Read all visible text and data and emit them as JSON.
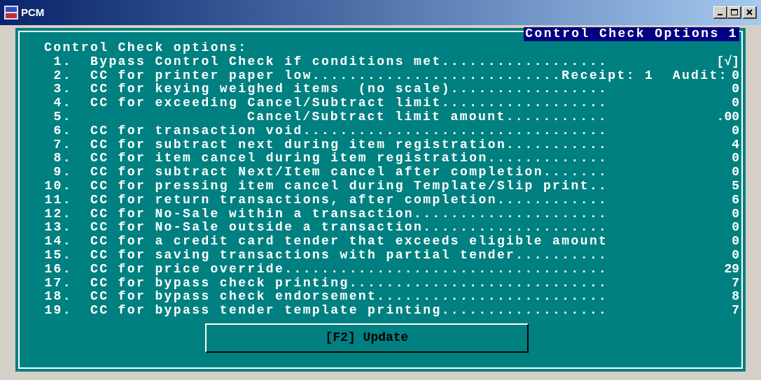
{
  "window": {
    "title": "PCM"
  },
  "panel": {
    "title": "Control Check Options 1",
    "heading": "Control Check options:"
  },
  "items": [
    {
      "number": "1.",
      "kind": "item",
      "label": "Bypass Control Check if conditions met..................",
      "value": "[√]"
    },
    {
      "number": "2.",
      "kind": "item",
      "label": "CC for printer paper low...........................Receipt: 1  Audit:",
      "value": "0"
    },
    {
      "number": "3.",
      "kind": "item",
      "label": "CC for keying weighed items  (no scale).................",
      "value": "0"
    },
    {
      "number": "4.",
      "kind": "item",
      "label": "CC for exceeding Cancel/Subtract limit..................",
      "value": "0"
    },
    {
      "number": "5.",
      "kind": "subitem",
      "label": "Cancel/Subtract limit amount...........",
      "value": ".00"
    },
    {
      "number": "6.",
      "kind": "item",
      "label": "CC for transaction void.................................",
      "value": "0"
    },
    {
      "number": "7.",
      "kind": "item",
      "label": "CC for subtract next during item registration...........",
      "value": "4"
    },
    {
      "number": "8.",
      "kind": "item",
      "label": "CC for item cancel during item registration.............",
      "value": "0"
    },
    {
      "number": "9.",
      "kind": "item",
      "label": "CC for subtract Next/Item cancel after completion.......",
      "value": "0"
    },
    {
      "number": "10.",
      "kind": "item",
      "label": "CC for pressing item cancel during Template/Slip print..",
      "value": "5"
    },
    {
      "number": "11.",
      "kind": "item",
      "label": "CC for return transactions, after completion............",
      "value": "6"
    },
    {
      "number": "12.",
      "kind": "item",
      "label": "CC for No-Sale within a transaction.....................",
      "value": "0"
    },
    {
      "number": "13.",
      "kind": "item",
      "label": "CC for No-Sale outside a transaction....................",
      "value": "0"
    },
    {
      "number": "14.",
      "kind": "item",
      "label": "CC for a credit card tender that exceeds eligible amount",
      "value": "0"
    },
    {
      "number": "15.",
      "kind": "item",
      "label": "CC for saving transactions with partial tender..........",
      "value": "0"
    },
    {
      "number": "16.",
      "kind": "item",
      "label": "CC for price override...................................",
      "value": "29"
    },
    {
      "number": "17.",
      "kind": "item",
      "label": "CC for bypass check printing............................",
      "value": "7"
    },
    {
      "number": "18.",
      "kind": "item",
      "label": "CC for bypass check endorsement.........................",
      "value": "8"
    },
    {
      "number": "19.",
      "kind": "item",
      "label": "CC for bypass tender template printing..................",
      "value": "7"
    }
  ],
  "update_button": "[F2] Update"
}
